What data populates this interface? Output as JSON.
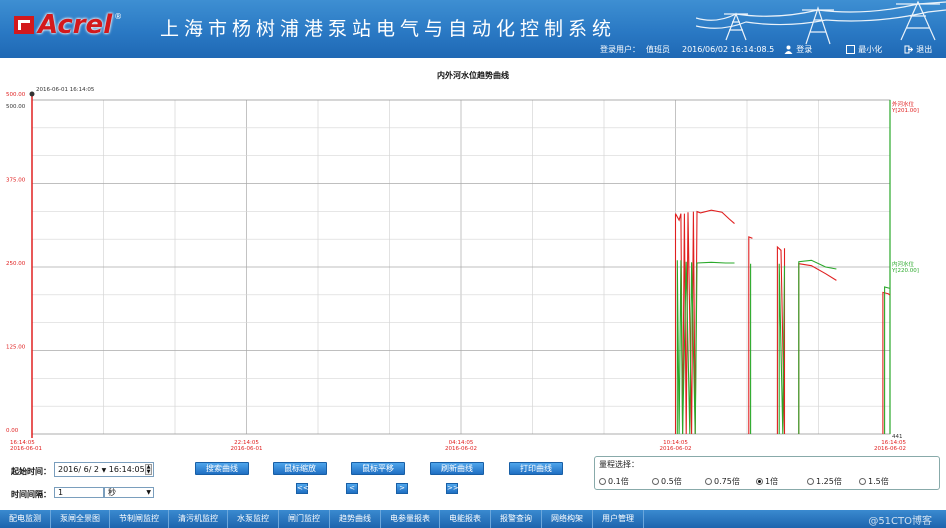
{
  "header": {
    "logo_text": "Acrel",
    "logo_reg": "®",
    "system_title": "上海市杨树浦港泵站电气与自动化控制系统",
    "user_label": "登录用户：",
    "user_name": "值班员",
    "datetime": "2016/06/02 16:14:08.5",
    "login_label": "登录",
    "minimize_label": "最小化",
    "exit_label": "退出"
  },
  "chart_data": {
    "type": "line",
    "title": "内外河水位趋势曲线",
    "cursor_time": "2016-06-01 16:14:05",
    "ylim": [
      0,
      500
    ],
    "y_ticks": [
      "0.00",
      "125.00",
      "250.00",
      "375.00",
      "500.00"
    ],
    "y_top_label": "500.00",
    "x_ticks": [
      {
        "time": "16:14:05",
        "date": "2016-06-01",
        "t": 0
      },
      {
        "time": "22:14:05",
        "date": "2016-06-01",
        "t": 6
      },
      {
        "time": "04:14:05",
        "date": "2016-06-02",
        "t": 12
      },
      {
        "time": "10:14:05",
        "date": "2016-06-02",
        "t": 18
      },
      {
        "time": "16:14:05",
        "date": "2016-06-02",
        "t": 24
      }
    ],
    "x_end_marker": "441",
    "series": [
      {
        "name": "外河水位",
        "value_label": "Y[201.00]",
        "color": "#e02020",
        "segments": [
          [
            [
              18.0,
              0
            ],
            [
              18.0,
              330
            ],
            [
              18.1,
              320
            ],
            [
              18.15,
              330
            ],
            [
              18.2,
              0
            ],
            [
              18.25,
              330
            ],
            [
              18.3,
              0
            ],
            [
              18.35,
              332
            ],
            [
              18.45,
              0
            ],
            [
              18.5,
              333
            ],
            [
              18.55,
              0
            ],
            [
              18.6,
              333
            ],
            [
              18.7,
              331
            ],
            [
              19.0,
              335
            ],
            [
              19.3,
              332
            ],
            [
              19.5,
              322
            ],
            [
              19.65,
              315
            ]
          ],
          [
            [
              20.05,
              0
            ],
            [
              20.05,
              295
            ],
            [
              20.15,
              293
            ]
          ],
          [
            [
              20.85,
              0
            ],
            [
              20.85,
              280
            ],
            [
              20.95,
              275
            ],
            [
              21.05,
              0
            ],
            [
              21.05,
              278
            ]
          ],
          [
            [
              21.45,
              0
            ],
            [
              21.45,
              255
            ],
            [
              21.8,
              252
            ],
            [
              22.2,
              240
            ],
            [
              22.5,
              230
            ]
          ],
          [
            [
              23.8,
              0
            ],
            [
              23.8,
              212
            ],
            [
              23.95,
              210
            ],
            [
              24.0,
              208
            ]
          ]
        ]
      },
      {
        "name": "内河水位",
        "value_label": "Y[220.00]",
        "color": "#2aa82a",
        "segments": [
          [
            [
              18.05,
              0
            ],
            [
              18.05,
              260
            ],
            [
              18.1,
              0
            ],
            [
              18.15,
              260
            ],
            [
              18.2,
              0
            ],
            [
              18.3,
              258
            ],
            [
              18.4,
              0
            ],
            [
              18.45,
              257
            ],
            [
              18.55,
              0
            ],
            [
              18.6,
              256
            ],
            [
              19.0,
              257
            ],
            [
              19.4,
              256
            ],
            [
              19.65,
              256
            ]
          ],
          [
            [
              20.1,
              0
            ],
            [
              20.1,
              255
            ]
          ],
          [
            [
              20.9,
              0
            ],
            [
              20.9,
              255
            ],
            [
              21.0,
              0
            ],
            [
              21.05,
              252
            ]
          ],
          [
            [
              21.45,
              0
            ],
            [
              21.45,
              258
            ],
            [
              21.8,
              260
            ],
            [
              22.2,
              250
            ],
            [
              22.5,
              247
            ]
          ],
          [
            [
              23.85,
              0
            ],
            [
              23.85,
              220
            ],
            [
              24.0,
              218
            ]
          ]
        ]
      }
    ]
  },
  "controls": {
    "start_label": "起始时间：",
    "start_date": "2016/ 6/ 2",
    "start_time": "16:14:05",
    "interval_label": "时间间隔：",
    "interval_value": "1",
    "interval_unit": "秒",
    "buttons": [
      "搜索曲线",
      "鼠标缩放",
      "鼠标平移",
      "刷新曲线",
      "打印曲线"
    ],
    "nav_buttons": [
      "<<",
      "<",
      ">",
      ">>"
    ],
    "range_title": "量程选择：",
    "range_options": [
      "0.1倍",
      "0.5倍",
      "0.75倍",
      "1倍",
      "1.25倍",
      "1.5倍"
    ],
    "range_selected": 3
  },
  "nav": [
    "配电监测",
    "泵闸全景图",
    "节制闸监控",
    "清污机监控",
    "水泵监控",
    "闸门监控",
    "趋势曲线",
    "电参量报表",
    "电能报表",
    "报警查询",
    "网络构架",
    "用户管理"
  ],
  "watermark": "@51CTO博客"
}
